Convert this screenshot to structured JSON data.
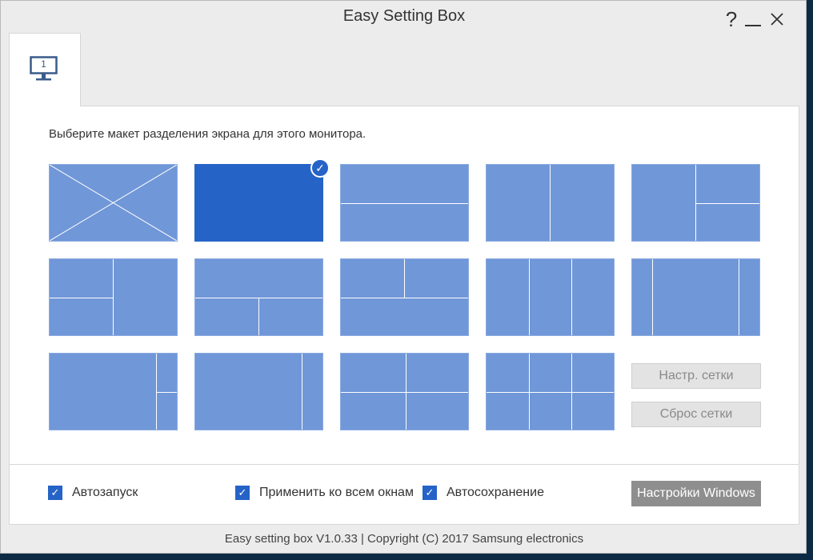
{
  "window": {
    "title": "Easy Setting Box",
    "help_label": "?",
    "minimize_label": "",
    "close_label": "✕"
  },
  "tabs": [
    {
      "label": "1",
      "icon": "monitor-icon",
      "selected": true
    }
  ],
  "main": {
    "instruction": "Выберите макет разделения экрана для этого монитора.",
    "layouts_selected_index": 1,
    "grid_settings_label": "Настр. сетки",
    "reset_grid_label": "Сброс сетки",
    "selected_mark": "✓"
  },
  "options": {
    "autostart": {
      "label": "Автозапуск",
      "checked": true
    },
    "apply_all_windows": {
      "label": "Применить ко всем окнам",
      "checked": true
    },
    "autosave": {
      "label": "Автосохранение",
      "checked": true
    },
    "check_mark": "✓",
    "windows_settings_label": "Настройки Windows"
  },
  "footer": {
    "text": "Easy setting box V1.0.33 | Copyright (C) 2017 Samsung electronics"
  },
  "colors": {
    "layout_fill": "#7097d8",
    "layout_selected": "#2563c7",
    "checkbox": "#2563c7",
    "windows_button": "#8e8e8e"
  }
}
